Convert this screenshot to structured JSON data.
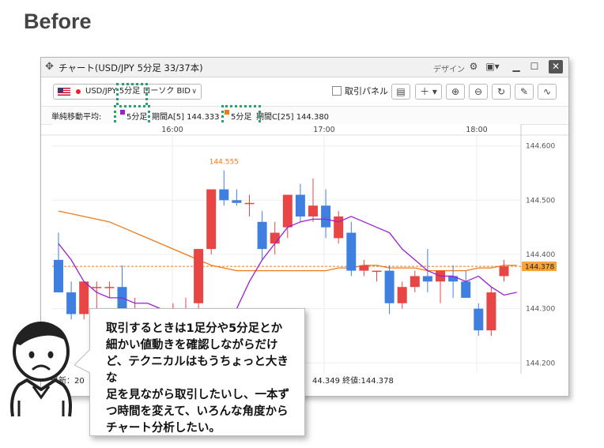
{
  "heading": "Before",
  "window": {
    "title": "チャート(USD/JPY 5分足 33/37本)",
    "design_label": "デザイン"
  },
  "toolbar": {
    "symbol_label": "USD/JPY 5分足 ローソク BID",
    "trade_panel_label": "取引パネル"
  },
  "ma_bar": {
    "label": "単純移動平均:",
    "ma1": {
      "tf": "5分足",
      "text": "期間A[5] 144.333",
      "color": "#9b1fd1"
    },
    "ma2": {
      "tf": "5分足",
      "text": "期間C[25] 144.380",
      "color": "#f07a1a"
    }
  },
  "footer": {
    "left": "最新：20",
    "right": "44.349 終値:144.378"
  },
  "bubble_text": "取引するときは1足分や5分足とか\n細かい値動きを確認しながらだけ\nど、テクニカルはもうちょっと大きな\n足を見ながら取引したいし、一本ず\nつ時間を変えて、いろんな角度から\nチャート分析したい。",
  "chart_data": {
    "type": "candlestick",
    "x_ticks": [
      "16:00",
      "17:00",
      "18:00"
    ],
    "y_ticks": [
      "144.600",
      "144.500",
      "144.400",
      "144.300",
      "144.200"
    ],
    "ylim": [
      144.18,
      144.62
    ],
    "high_annotation": "144.555",
    "current_price": "144.378",
    "colors": {
      "up": "#e84545",
      "down": "#3f7fe0",
      "ma_short": "#9b1fd1",
      "ma_long": "#f07a1a"
    },
    "candles": [
      {
        "o": 144.39,
        "h": 144.44,
        "l": 144.33,
        "c": 144.33
      },
      {
        "o": 144.33,
        "h": 144.35,
        "l": 144.28,
        "c": 144.29
      },
      {
        "o": 144.29,
        "h": 144.35,
        "l": 144.28,
        "c": 144.35
      },
      {
        "o": 144.34,
        "h": 144.35,
        "l": 144.27,
        "c": 144.34
      },
      {
        "o": 144.34,
        "h": 144.35,
        "l": 144.32,
        "c": 144.34
      },
      {
        "o": 144.34,
        "h": 144.38,
        "l": 144.28,
        "c": 144.29
      },
      {
        "o": 144.28,
        "h": 144.32,
        "l": 144.27,
        "c": 144.28
      },
      {
        "o": 144.28,
        "h": 144.29,
        "l": 144.25,
        "c": 144.26
      },
      {
        "o": 144.27,
        "h": 144.3,
        "l": 144.24,
        "c": 144.26
      },
      {
        "o": 144.25,
        "h": 144.31,
        "l": 144.24,
        "c": 144.27
      },
      {
        "o": 144.29,
        "h": 144.32,
        "l": 144.24,
        "c": 144.3
      },
      {
        "o": 144.31,
        "h": 144.41,
        "l": 144.29,
        "c": 144.41
      },
      {
        "o": 144.41,
        "h": 144.52,
        "l": 144.4,
        "c": 144.52
      },
      {
        "o": 144.52,
        "h": 144.555,
        "l": 144.49,
        "c": 144.5
      },
      {
        "o": 144.5,
        "h": 144.52,
        "l": 144.49,
        "c": 144.495
      },
      {
        "o": 144.495,
        "h": 144.51,
        "l": 144.47,
        "c": 144.495
      },
      {
        "o": 144.46,
        "h": 144.48,
        "l": 144.39,
        "c": 144.41
      },
      {
        "o": 144.42,
        "h": 144.46,
        "l": 144.4,
        "c": 144.44
      },
      {
        "o": 144.45,
        "h": 144.51,
        "l": 144.43,
        "c": 144.51
      },
      {
        "o": 144.51,
        "h": 144.53,
        "l": 144.46,
        "c": 144.47
      },
      {
        "o": 144.47,
        "h": 144.54,
        "l": 144.46,
        "c": 144.49
      },
      {
        "o": 144.49,
        "h": 144.52,
        "l": 144.43,
        "c": 144.45
      },
      {
        "o": 144.43,
        "h": 144.48,
        "l": 144.42,
        "c": 144.47
      },
      {
        "o": 144.44,
        "h": 144.46,
        "l": 144.36,
        "c": 144.37
      },
      {
        "o": 144.37,
        "h": 144.39,
        "l": 144.36,
        "c": 144.38
      },
      {
        "o": 144.37,
        "h": 144.37,
        "l": 144.35,
        "c": 144.37
      },
      {
        "o": 144.37,
        "h": 144.38,
        "l": 144.29,
        "c": 144.31
      },
      {
        "o": 144.31,
        "h": 144.35,
        "l": 144.3,
        "c": 144.34
      },
      {
        "o": 144.34,
        "h": 144.37,
        "l": 144.33,
        "c": 144.36
      },
      {
        "o": 144.36,
        "h": 144.41,
        "l": 144.33,
        "c": 144.35
      },
      {
        "o": 144.35,
        "h": 144.37,
        "l": 144.31,
        "c": 144.37
      },
      {
        "o": 144.36,
        "h": 144.38,
        "l": 144.32,
        "c": 144.35
      },
      {
        "o": 144.35,
        "h": 144.37,
        "l": 144.32,
        "c": 144.32
      },
      {
        "o": 144.3,
        "h": 144.31,
        "l": 144.25,
        "c": 144.26
      },
      {
        "o": 144.26,
        "h": 144.34,
        "l": 144.25,
        "c": 144.33
      },
      {
        "o": 144.36,
        "h": 144.39,
        "l": 144.35,
        "c": 144.378
      }
    ],
    "ma_short": [
      144.42,
      144.39,
      144.35,
      144.33,
      144.32,
      144.32,
      144.31,
      144.31,
      144.3,
      144.29,
      144.28,
      144.27,
      144.27,
      144.28,
      144.3,
      144.35,
      144.39,
      144.42,
      144.45,
      144.46,
      144.465,
      144.465,
      144.46,
      144.47,
      144.46,
      144.45,
      144.44,
      144.41,
      144.39,
      144.37,
      144.36,
      144.36,
      144.35,
      144.36,
      144.34,
      144.325,
      144.33
    ],
    "ma_long": [
      144.48,
      144.475,
      144.47,
      144.465,
      144.46,
      144.45,
      144.44,
      144.43,
      144.42,
      144.41,
      144.4,
      144.39,
      144.38,
      144.375,
      144.37,
      144.37,
      144.37,
      144.37,
      144.37,
      144.37,
      144.37,
      144.37,
      144.375,
      144.375,
      144.38,
      144.38,
      144.375,
      144.375,
      144.375,
      144.37,
      144.37,
      144.37,
      144.37,
      144.375,
      144.375,
      144.38,
      144.38
    ]
  }
}
